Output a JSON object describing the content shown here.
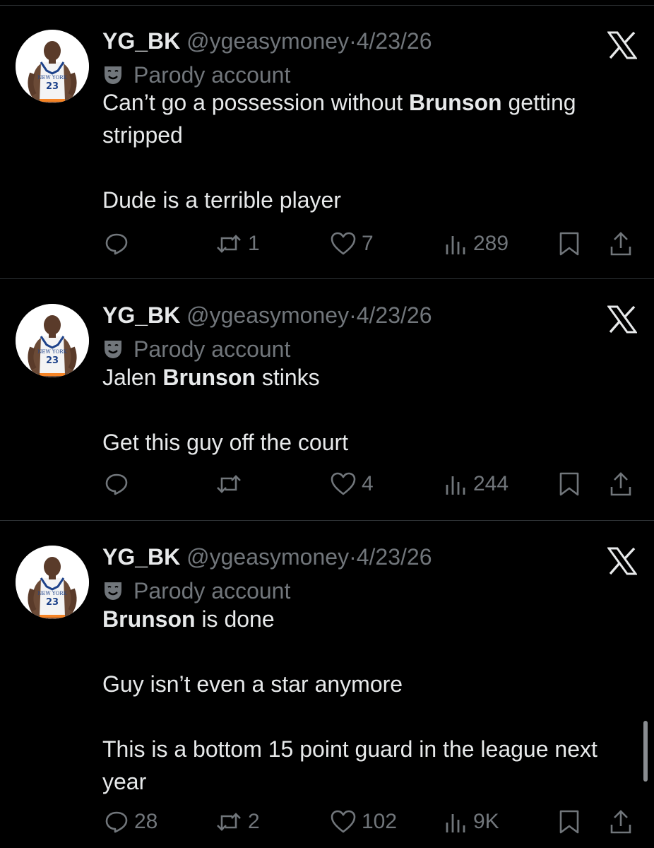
{
  "colors": {
    "background": "#000000",
    "text": "#e7e9ea",
    "muted": "#71767b",
    "divider": "#2f3336"
  },
  "tweets": [
    {
      "author_name": "YG_BK",
      "handle": "@ygeasymoney",
      "separator": "·",
      "date": "4/23/26",
      "badge_text": "Parody account",
      "badge_icon": "mask-icon",
      "paragraphs": [
        {
          "parts": [
            {
              "t": "Can’t go a possession without "
            },
            {
              "t": "Brunson",
              "b": true
            },
            {
              "t": " getting stripped"
            }
          ]
        },
        {
          "parts": [
            {
              "t": "Dude is a terrible player"
            }
          ]
        }
      ],
      "replies": "",
      "reposts": "1",
      "likes": "7",
      "views": "289"
    },
    {
      "author_name": "YG_BK",
      "handle": "@ygeasymoney",
      "separator": "·",
      "date": "4/23/26",
      "badge_text": "Parody account",
      "badge_icon": "mask-icon",
      "paragraphs": [
        {
          "parts": [
            {
              "t": "Jalen "
            },
            {
              "t": "Brunson",
              "b": true
            },
            {
              "t": " stinks"
            }
          ]
        },
        {
          "parts": [
            {
              "t": "Get this guy off the court"
            }
          ]
        }
      ],
      "replies": "",
      "reposts": "",
      "likes": "4",
      "views": "244"
    },
    {
      "author_name": "YG_BK",
      "handle": "@ygeasymoney",
      "separator": "·",
      "date": "4/23/26",
      "badge_text": "Parody account",
      "badge_icon": "mask-icon",
      "paragraphs": [
        {
          "parts": [
            {
              "t": "Brunson",
              "b": true
            },
            {
              "t": " is done"
            }
          ]
        },
        {
          "parts": [
            {
              "t": "Guy isn’t even a star anymore"
            }
          ]
        },
        {
          "parts": [
            {
              "t": "This is a bottom 15 point guard in the league next year"
            }
          ]
        }
      ],
      "replies": "28",
      "reposts": "2",
      "likes": "102",
      "views": "9K"
    }
  ],
  "avatar": {
    "jersey_text": "NEW YORK",
    "jersey_number": "23"
  }
}
